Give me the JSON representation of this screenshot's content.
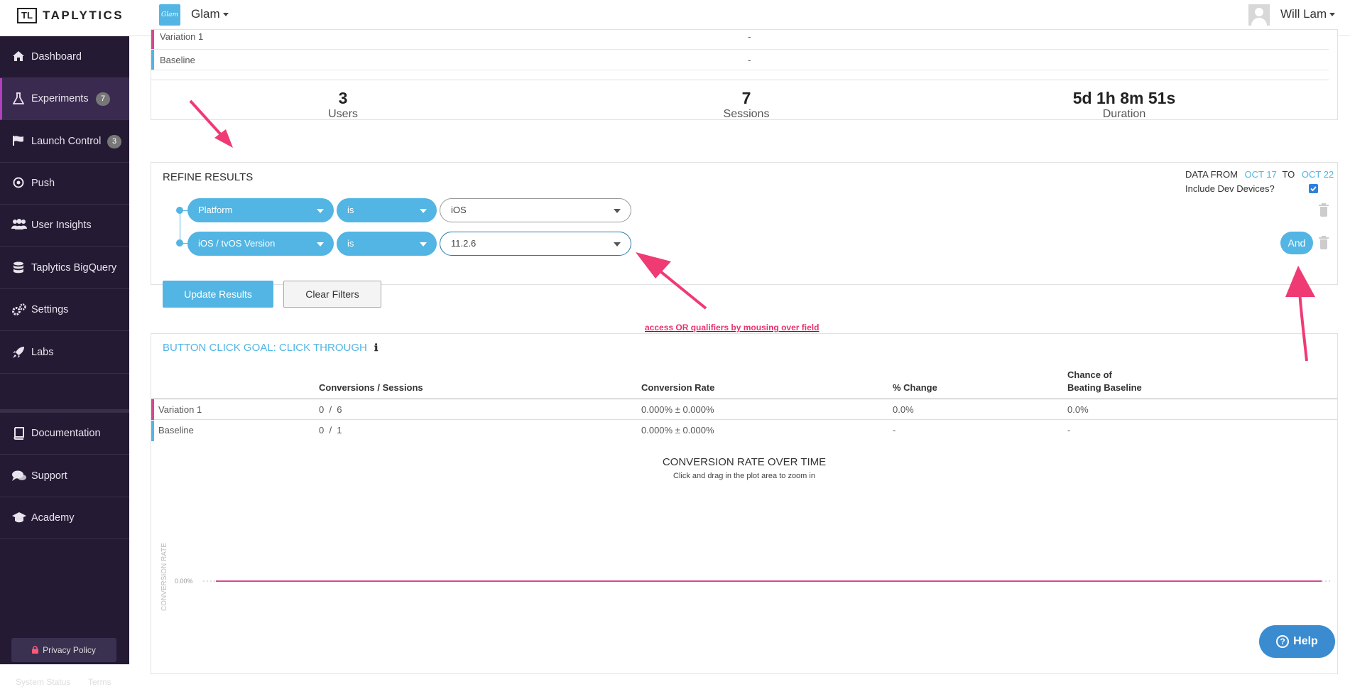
{
  "topbar": {
    "logo_mark": "TL",
    "brand": "TAPLYTICS",
    "app_icon_text": "Glam",
    "app_name": "Glam",
    "user_name": "Will Lam"
  },
  "sidebar": {
    "items": [
      {
        "label": "Dashboard",
        "icon": "home-icon"
      },
      {
        "label": "Experiments",
        "icon": "flask-icon",
        "badge": "7"
      },
      {
        "label": "Launch Control",
        "icon": "flag-icon",
        "badge": "3"
      },
      {
        "label": "Push",
        "icon": "target-icon"
      },
      {
        "label": "User Insights",
        "icon": "users-icon"
      },
      {
        "label": "Taplytics BigQuery",
        "icon": "database-icon"
      },
      {
        "label": "Settings",
        "icon": "gear-icon"
      },
      {
        "label": "Labs",
        "icon": "rocket-icon"
      },
      {
        "label": "Documentation",
        "icon": "book-icon"
      },
      {
        "label": "Support",
        "icon": "chat-icon"
      },
      {
        "label": "Academy",
        "icon": "graduation-cap-icon"
      }
    ],
    "privacy_label": "Privacy Policy",
    "system_status_label": "System Status",
    "terms_label": "Terms"
  },
  "summary": {
    "variations": [
      {
        "name": "Variation 1",
        "value": "-",
        "color": "#d6478f"
      },
      {
        "name": "Baseline",
        "value": "-",
        "color": "#52b5e3"
      }
    ],
    "stats": [
      {
        "value": "3",
        "label": "Users"
      },
      {
        "value": "7",
        "label": "Sessions"
      },
      {
        "value": "5d 1h 8m 51s",
        "label": "Duration"
      }
    ]
  },
  "refine": {
    "title": "REFINE RESULTS",
    "data_from_label": "DATA FROM",
    "from_date": "OCT 17",
    "to_label": "TO",
    "to_date": "OCT 22",
    "include_dev_label": "Include Dev Devices?",
    "include_dev_checked": true,
    "filters": [
      {
        "field": "Platform",
        "operator": "is",
        "value": "iOS"
      },
      {
        "field": "iOS / tvOS Version",
        "operator": "is",
        "value": "11.2.6"
      }
    ],
    "and_label": "And",
    "update_label": "Update Results",
    "clear_label": "Clear Filters"
  },
  "annotation": {
    "text": "access OR qualifiers by mousing over field",
    "color": "#e8336d"
  },
  "goal": {
    "title": "BUTTON CLICK GOAL: CLICK THROUGH",
    "info_icon": "info-icon",
    "headers": [
      "Conversions / Sessions",
      "Conversion Rate",
      "% Change",
      "Chance of",
      "Beating Baseline"
    ],
    "rows": [
      {
        "name": "Variation 1",
        "conversions": "0  /  6",
        "rate": "0.000% ± 0.000%",
        "change": "0.0%",
        "chance": "0.0%",
        "color": "#d6478f"
      },
      {
        "name": "Baseline",
        "conversions": "0  /  1",
        "rate": "0.000% ± 0.000%",
        "change": "-",
        "chance": "-",
        "color": "#52b5e3"
      }
    ]
  },
  "chart_data": {
    "type": "line",
    "title": "CONVERSION RATE OVER TIME",
    "subtitle": "Click and drag in the plot area to zoom in",
    "ylabel": "CONVERSION RATE",
    "y_tick_labels": [
      "0.00%"
    ],
    "series": [
      {
        "name": "Variation 1",
        "values": [
          0,
          0
        ],
        "color": "#d6478f"
      },
      {
        "name": "Baseline",
        "values": [
          0,
          0
        ],
        "color": "#52b5e3"
      }
    ]
  },
  "help": {
    "label": "Help",
    "icon": "question-icon"
  }
}
